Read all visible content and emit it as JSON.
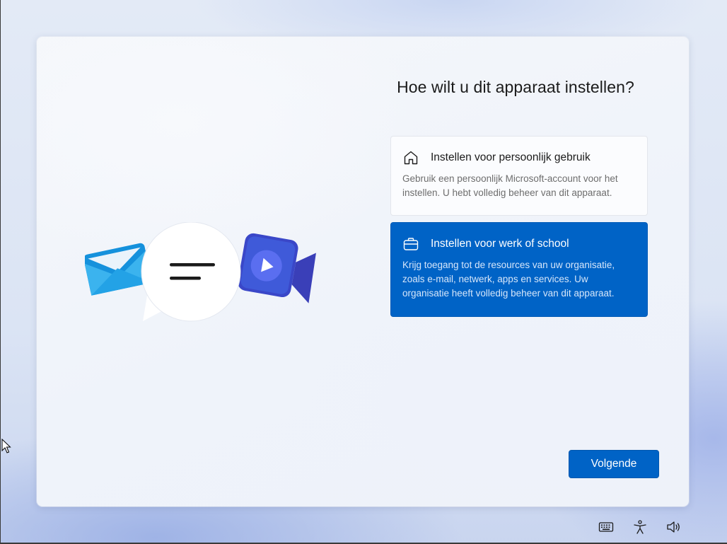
{
  "dialog": {
    "title": "Hoe wilt u dit apparaat instellen?",
    "options": [
      {
        "title": "Instellen voor persoonlijk gebruik",
        "description": "Gebruik een persoonlijk Microsoft-account voor het instellen. U hebt volledig beheer van dit apparaat.",
        "icon": "home-icon",
        "selected": false
      },
      {
        "title": "Instellen voor werk of school",
        "description": "Krijg toegang tot de resources van uw organisatie, zoals e-mail, netwerk, apps en services. Uw organisatie heeft volledig beheer van dit apparaat.",
        "icon": "briefcase-icon",
        "selected": true
      }
    ],
    "next_label": "Volgende"
  },
  "taskbar": {
    "icons": [
      "keyboard-icon",
      "accessibility-icon",
      "volume-icon"
    ]
  },
  "colors": {
    "accent": "#0063c6",
    "title_text": "#1b1b1b",
    "desc_text": "#6d6d6d"
  }
}
